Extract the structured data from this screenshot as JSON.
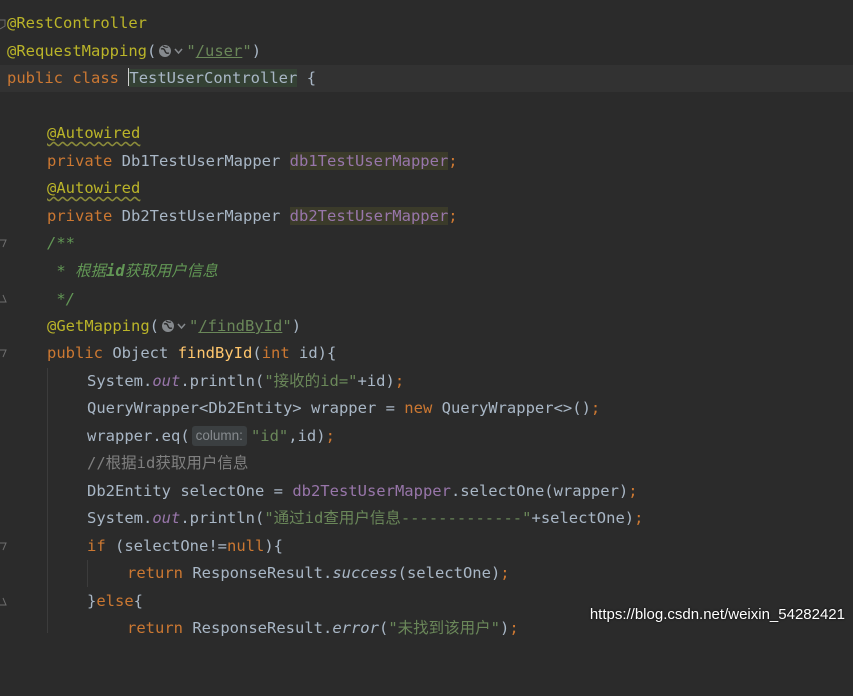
{
  "editor": {
    "lines": {
      "l1": {
        "annotation": "@RestController"
      },
      "l2": {
        "annotation": "@RequestMapping",
        "open": "(",
        "path_q1": "\"",
        "path": "/user",
        "path_q2": "\"",
        "close": ")"
      },
      "l3": {
        "kw_public": "public",
        "kw_class": "class",
        "class_name": "TestUserController",
        "brace": "{"
      },
      "l5": {
        "annotation": "@Autowired"
      },
      "l6": {
        "kw": "private",
        "type": "Db1TestUserMapper",
        "field": "db1TestUserMapper",
        "semi": ";"
      },
      "l7": {
        "annotation": "@Autowired"
      },
      "l8": {
        "kw": "private",
        "type": "Db2TestUserMapper",
        "field": "db2TestUserMapper",
        "semi": ";"
      },
      "l9": {
        "doc": "/**"
      },
      "l10": {
        "doc_star": " * ",
        "doc_text1": "根据",
        "doc_bold": "id",
        "doc_text2": "获取用户信息"
      },
      "l11": {
        "doc": " */"
      },
      "l12": {
        "annotation": "@GetMapping",
        "open": "(",
        "path_q1": "\"",
        "path": "/findById",
        "path_q2": "\"",
        "close": ")"
      },
      "l13": {
        "kw_public": "public",
        "type": "Object",
        "method": "findById",
        "open": "(",
        "kw_int": "int",
        "param": " id){"
      },
      "l14": {
        "sys": "System.",
        "out": "out",
        "println": ".println(",
        "str": "\"接收的id=\"",
        "rest": "+id)",
        "semi": ";"
      },
      "l15": {
        "type": "QueryWrapper<Db2Entity> wrapper = ",
        "kw_new": "new",
        "rest": " QueryWrapper<>()",
        "semi": ";"
      },
      "l16": {
        "call": "wrapper.eq(",
        "hint": "column:",
        "str": "\"id\"",
        "rest": ",id)",
        "semi": ";"
      },
      "l17": {
        "comment": "//根据id获取用户信息"
      },
      "l18": {
        "decl": "Db2Entity selectOne = ",
        "field": "db2TestUserMapper",
        "rest": ".selectOne(wrapper)",
        "semi": ";"
      },
      "l19": {
        "sys": "System.",
        "out": "out",
        "println": ".println(",
        "str": "\"通过id查用户信息-------------\"",
        "rest": "+selectOne)",
        "semi": ";"
      },
      "l20": {
        "kw_if": "if",
        "cond1": " (selectOne!=",
        "kw_null": "null",
        "cond2": "){"
      },
      "l21": {
        "kw_return": "return",
        "cls": " ResponseResult.",
        "method": "success",
        "rest": "(selectOne)",
        "semi": ";"
      },
      "l22": {
        "else1": "}",
        "kw_else": "else",
        "else2": "{"
      },
      "l23": {
        "kw_return": "return",
        "cls": " ResponseResult.",
        "method": "error",
        "open": "(",
        "str": "\"未找到该用户\"",
        "rest": ")",
        "semi": ";"
      }
    },
    "globe_icon": "globe-icon",
    "dropdown_icon": "chevron-down-icon"
  },
  "watermark": "https://blog.csdn.net/weixin_54282421",
  "colors": {
    "background": "#2b2b2b",
    "annotation": "#bbb529",
    "keyword": "#cc7832",
    "string": "#6a8759",
    "field": "#9876aa",
    "method": "#ffc66d",
    "comment": "#808080",
    "doc": "#629755"
  }
}
